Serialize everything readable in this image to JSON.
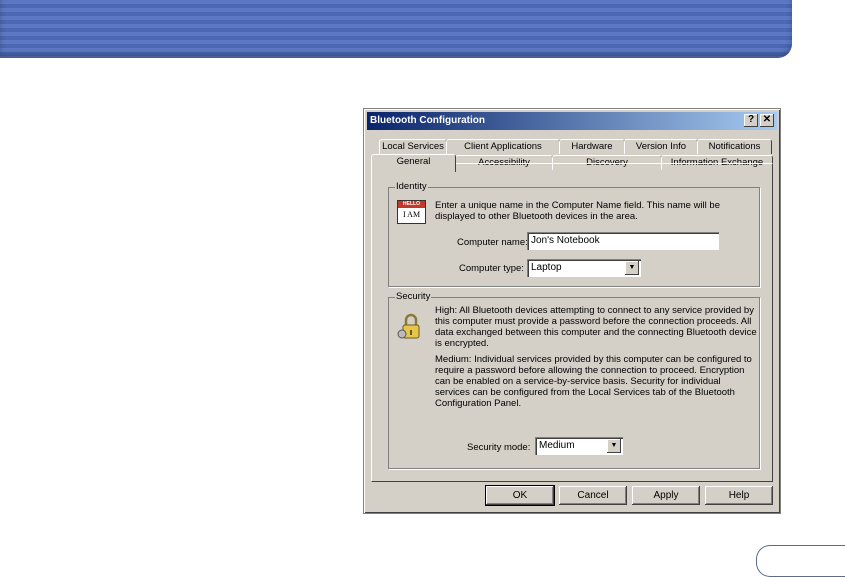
{
  "dialog": {
    "title": "Bluetooth Configuration",
    "help_btn": "?",
    "close_btn": "✕"
  },
  "tabs_row1": [
    "Local Services",
    "Client Applications",
    "Hardware",
    "Version Info",
    "Notifications"
  ],
  "tabs_row2": [
    "General",
    "Accessibility",
    "Discovery",
    "Information Exchange"
  ],
  "identity": {
    "group_label": "Identity",
    "icon_text_top": "HELLO",
    "icon_text_bottom": "I AM",
    "description": "Enter a unique name in the Computer Name field. This name will be displayed to other Bluetooth devices in the area.",
    "computer_name_label": "Computer name:",
    "computer_name_value": "Jon's Notebook",
    "computer_type_label": "Computer type:",
    "computer_type_value": "Laptop"
  },
  "security": {
    "group_label": "Security",
    "high_text": "High: All Bluetooth devices attempting to connect to any service provided by this computer must provide a password before the connection proceeds. All data exchanged between this computer and the connecting Bluetooth device is encrypted.",
    "medium_text": "Medium: Individual services provided by this computer can be configured to require a password before allowing the connection to proceed. Encryption can be enabled on a service-by-service basis. Security for individual services can be configured from the Local Services tab of the Bluetooth Configuration Panel.",
    "mode_label": "Security mode:",
    "mode_value": "Medium"
  },
  "buttons": {
    "ok": "OK",
    "cancel": "Cancel",
    "apply": "Apply",
    "help": "Help"
  }
}
